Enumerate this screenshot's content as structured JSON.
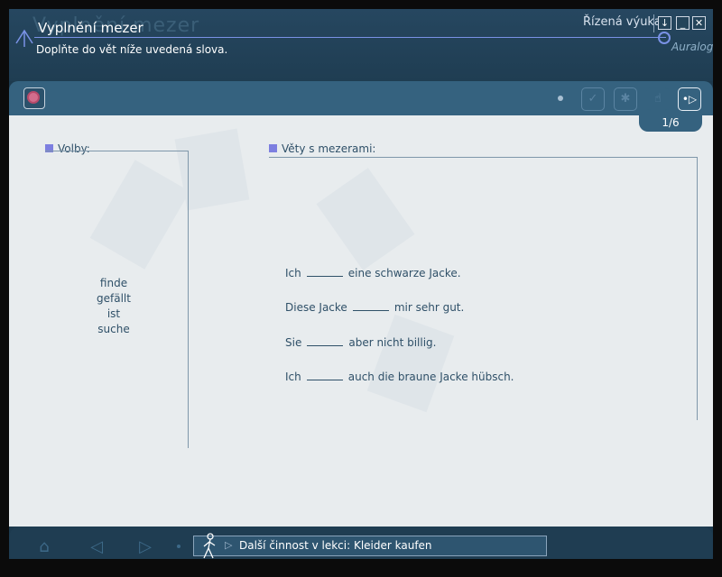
{
  "header": {
    "title": "Vyplnění mezer",
    "ghost_title": "Vyplnění mezer",
    "subtitle": "Doplňte do vět níže uvedená slova.",
    "mode_label": "Řízená výuka",
    "brand": "Auralog",
    "window_buttons": [
      "↓",
      "_",
      "✕"
    ]
  },
  "toolbar": {
    "record_icon": "record-icon",
    "icons": [
      "check-icon",
      "lightbulb-icon",
      "hint-icon"
    ],
    "next_icon": "play-next-icon"
  },
  "page_indicator": "1/6",
  "left_panel": {
    "label": "Volby:",
    "choices": [
      "finde",
      "gefällt",
      "ist",
      "suche"
    ]
  },
  "right_panel": {
    "label": "Věty s mezerami:",
    "sentences": [
      {
        "before": "Ich",
        "after": "eine schwarze Jacke."
      },
      {
        "before": "Diese Jacke",
        "after": "mir sehr gut."
      },
      {
        "before": "Sie",
        "after": "aber nicht billig."
      },
      {
        "before": "Ich",
        "after": "auch die braune Jacke hübsch."
      }
    ]
  },
  "footer": {
    "next_activity": "Další činnost v lekci: Kleider kaufen"
  },
  "colors": {
    "header_bg": "#264760",
    "toolbar_bg": "#35627f",
    "content_bg": "#e8ecee",
    "accent_line": "#7a92e6",
    "text": "#2f5068"
  }
}
